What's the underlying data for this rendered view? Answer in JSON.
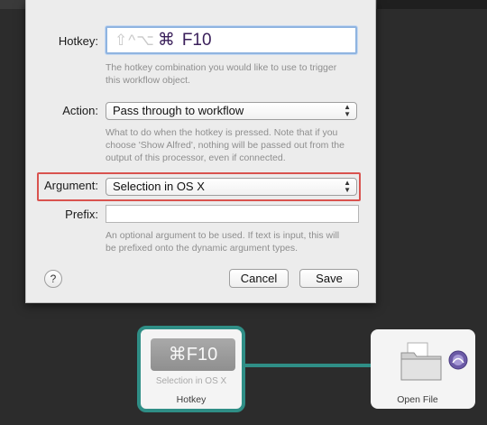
{
  "dialog": {
    "hotkey_label": "Hotkey:",
    "hotkey_modifiers": "⇧^⌥",
    "hotkey_command": "⌘",
    "hotkey_key": "F10",
    "hotkey_help": "The hotkey combination you would like to use to trigger this workflow object.",
    "action_label": "Action:",
    "action_value": "Pass through to workflow",
    "action_help": "What to do when the hotkey is pressed. Note that if you choose 'Show Alfred', nothing will be passed out from the output of this processor, even if connected.",
    "argument_label": "Argument:",
    "argument_value": "Selection in OS X",
    "prefix_label": "Prefix:",
    "prefix_value": "",
    "prefix_help": "An optional argument to be used. If text is input, this will be prefixed onto the dynamic argument types.",
    "help_button": "?",
    "cancel_label": "Cancel",
    "save_label": "Save"
  },
  "workflow": {
    "hotkey_node": {
      "key": "⌘F10",
      "subtitle": "Selection in OS X",
      "title": "Hotkey"
    },
    "open_file_node": {
      "title": "Open File"
    }
  },
  "colors": {
    "accent_connection": "#2f8e86",
    "highlight_box": "#d9534f",
    "field_focus": "#8fb4e0"
  },
  "icons": [
    "folder-icon",
    "alfred-hat-icon",
    "select-arrows-icon",
    "help-icon"
  ]
}
